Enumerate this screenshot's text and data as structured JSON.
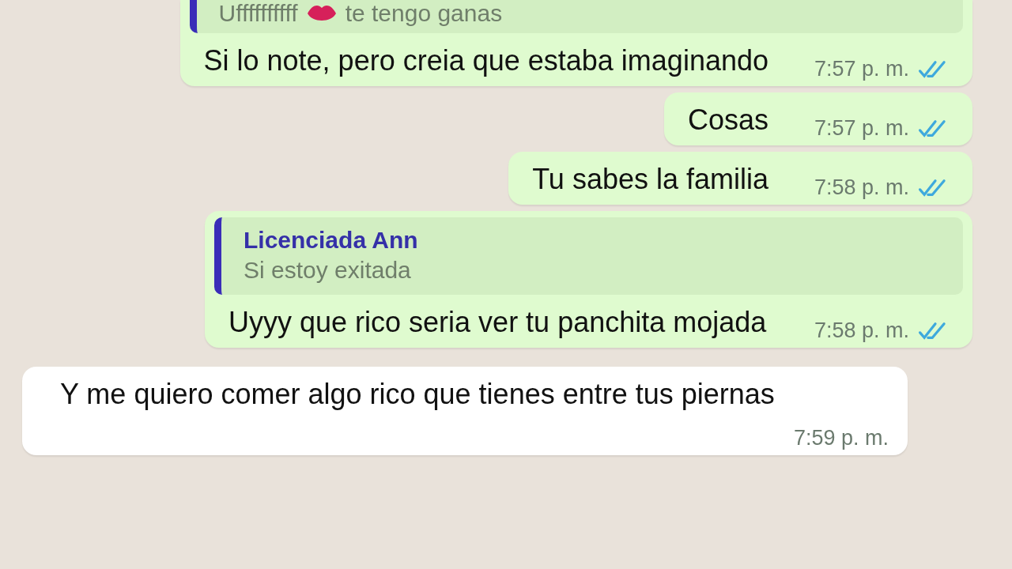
{
  "messages": [
    {
      "kind": "outgoing",
      "quote": {
        "text_before": "Uffffffffff",
        "text_after": "te tengo ganas"
      },
      "text": "Si lo note, pero creia que estaba imaginando",
      "time": "7:57 p. m.",
      "read": true
    },
    {
      "kind": "outgoing",
      "text": "Cosas",
      "time": "7:57 p. m.",
      "read": true
    },
    {
      "kind": "outgoing",
      "text": "Tu sabes la familia",
      "time": "7:58 p. m.",
      "read": true
    },
    {
      "kind": "outgoing",
      "quote": {
        "author": "Licenciada Ann",
        "text_before": "Si estoy exitada"
      },
      "text": "Uyyy que rico seria ver tu panchita mojada",
      "time": "7:58 p. m.",
      "read": true
    },
    {
      "kind": "incoming",
      "text": "Y me quiero comer algo rico que tienes entre tus piernas",
      "time": "7:59 p. m."
    }
  ]
}
